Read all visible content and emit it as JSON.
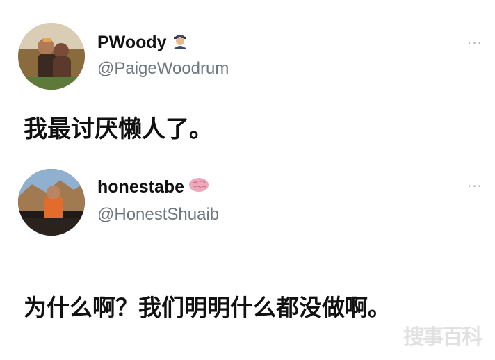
{
  "tweets": [
    {
      "display_name": "PWoody",
      "name_emoji": "person-with-cap-emoji",
      "handle": "@PaigeWoodrum",
      "text": "我最讨厌懒人了。",
      "more_glyph": "···"
    },
    {
      "display_name": "honestabe",
      "name_emoji": "brain-emoji",
      "handle": "@HonestShuaib",
      "text": "为什么啊？我们明明什么都没做啊。",
      "more_glyph": "···"
    }
  ],
  "watermark": "搜事百科",
  "colors": {
    "background": "#ffffff",
    "handle": "#6e767d",
    "more": "#b0b6bb",
    "text": "#111111"
  }
}
